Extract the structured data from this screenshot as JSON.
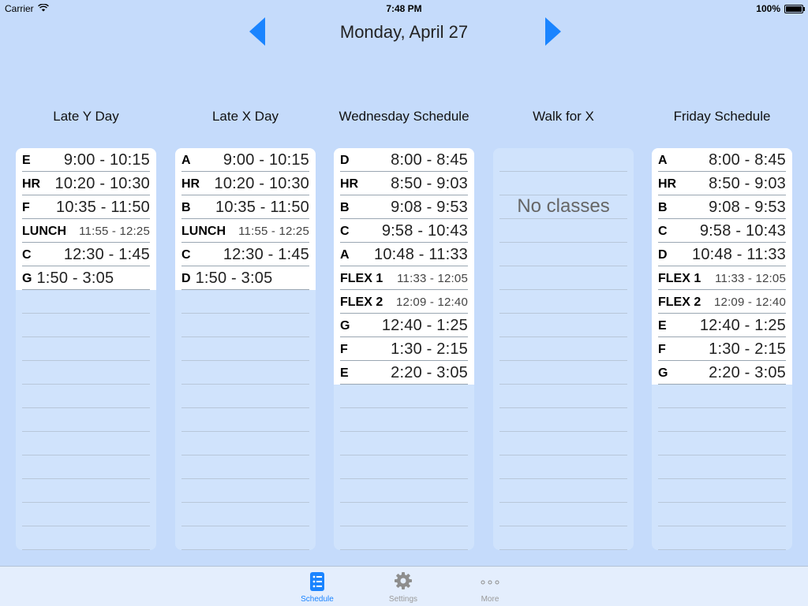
{
  "status_bar": {
    "carrier": "Carrier",
    "time": "7:48 PM",
    "battery": "100%"
  },
  "header": {
    "date": "Monday, April 27",
    "prev_icon": "triangle-left-icon",
    "next_icon": "triangle-right-icon",
    "accent_color": "#1a84ff"
  },
  "columns": [
    {
      "title": "Late Y Day",
      "periods": [
        {
          "letter": "E",
          "time": "9:00 - 10:15"
        },
        {
          "letter": "HR",
          "time": "10:20 - 10:30"
        },
        {
          "letter": "F",
          "time": "10:35 - 11:50"
        },
        {
          "letter": "LUNCH",
          "time": "11:55 - 12:25"
        },
        {
          "letter": "C",
          "time": "12:30 - 1:45"
        },
        {
          "letter": "G",
          "time": "1:50 - 3:05"
        }
      ]
    },
    {
      "title": "Late X Day",
      "periods": [
        {
          "letter": "A",
          "time": "9:00 - 10:15"
        },
        {
          "letter": "HR",
          "time": "10:20 - 10:30"
        },
        {
          "letter": "B",
          "time": "10:35 - 11:50"
        },
        {
          "letter": "LUNCH",
          "time": "11:55 - 12:25"
        },
        {
          "letter": "C",
          "time": "12:30 - 1:45"
        },
        {
          "letter": "D",
          "time": "1:50 - 3:05"
        }
      ]
    },
    {
      "title": "Wednesday Schedule",
      "periods": [
        {
          "letter": "D",
          "time": "8:00 - 8:45"
        },
        {
          "letter": "HR",
          "time": "8:50 - 9:03"
        },
        {
          "letter": "B",
          "time": "9:08 - 9:53"
        },
        {
          "letter": "C",
          "time": "9:58 - 10:43"
        },
        {
          "letter": "A",
          "time": "10:48 - 11:33"
        },
        {
          "letter": "FLEX 1",
          "time": "11:33 - 12:05"
        },
        {
          "letter": "FLEX 2",
          "time": "12:09 - 12:40"
        },
        {
          "letter": "G",
          "time": "12:40 - 1:25"
        },
        {
          "letter": "F",
          "time": "1:30 - 2:15"
        },
        {
          "letter": "E",
          "time": "2:20 - 3:05"
        }
      ]
    },
    {
      "title": "Walk for X",
      "periods": [],
      "empty_text": "No classes"
    },
    {
      "title": "Friday Schedule",
      "periods": [
        {
          "letter": "A",
          "time": "8:00 - 8:45"
        },
        {
          "letter": "HR",
          "time": "8:50 - 9:03"
        },
        {
          "letter": "B",
          "time": "9:08 - 9:53"
        },
        {
          "letter": "C",
          "time": "9:58 - 10:43"
        },
        {
          "letter": "D",
          "time": "10:48 - 11:33"
        },
        {
          "letter": "FLEX 1",
          "time": "11:33 - 12:05"
        },
        {
          "letter": "FLEX 2",
          "time": "12:09 - 12:40"
        },
        {
          "letter": "E",
          "time": "12:40 - 1:25"
        },
        {
          "letter": "F",
          "time": "1:30 - 2:15"
        },
        {
          "letter": "G",
          "time": "2:20 - 3:05"
        }
      ]
    }
  ],
  "tab_bar": {
    "tabs": [
      {
        "label": "Schedule",
        "icon": "list-icon",
        "active": true
      },
      {
        "label": "Settings",
        "icon": "gear-icon",
        "active": false
      },
      {
        "label": "More",
        "icon": "more-dots-icon",
        "active": false
      }
    ]
  }
}
